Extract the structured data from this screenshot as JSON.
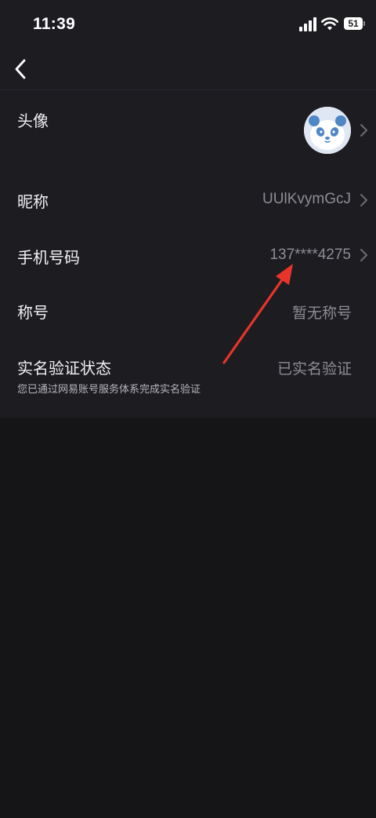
{
  "status_bar": {
    "time": "11:39",
    "battery_level": "51"
  },
  "nav": {
    "back_icon": "chevron-left-icon"
  },
  "rows": {
    "avatar": {
      "label": "头像",
      "icon": "panda-avatar"
    },
    "nickname": {
      "label": "昵称",
      "value": "UUlKvymGcJ"
    },
    "phone": {
      "label": "手机号码",
      "value": "137****4275"
    },
    "title": {
      "label": "称号",
      "value": "暂无称号"
    },
    "verify": {
      "label": "实名验证状态",
      "value": "已实名验证",
      "note": "您已通过网易账号服务体系完成实名验证"
    }
  },
  "colors": {
    "panel_bg": "#1d1c21",
    "page_bg": "#151417",
    "value_text": "#8e8d94",
    "annotation_arrow": "#e8342b"
  }
}
